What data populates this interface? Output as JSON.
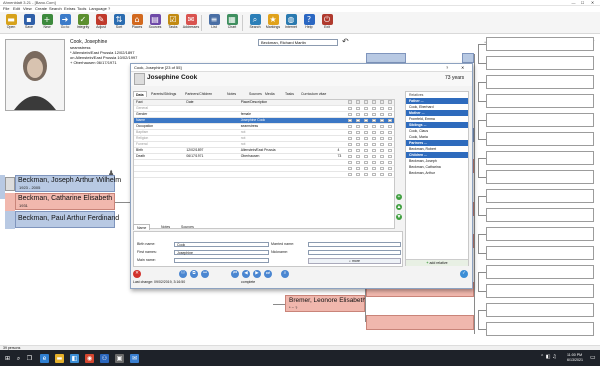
{
  "window": {
    "title": "Ahnenblatt 3.21 - [Bano.Com]",
    "min": "—",
    "max": "☐",
    "close": "✕"
  },
  "menu": [
    "File",
    "Edit",
    "View",
    "Create",
    "Search",
    "Extras",
    "Tools",
    "Language",
    "?"
  ],
  "toolbar": [
    {
      "label": "Open",
      "icon": "folder-icon",
      "color": "#d7a21b",
      "glyph": "▬"
    },
    {
      "label": "Save",
      "icon": "save-icon",
      "color": "#2f5fa8",
      "glyph": "▪"
    },
    {
      "label": "New",
      "icon": "new-person-icon",
      "color": "#3d8a3d",
      "glyph": "+"
    },
    {
      "label": "Go to",
      "icon": "goto-icon",
      "color": "#3b7bc9",
      "glyph": "➜"
    },
    {
      "label": "Integrity",
      "icon": "integrity-icon",
      "color": "#5b8f2f",
      "glyph": "✓"
    },
    {
      "label": "Adjust",
      "icon": "adjust-icon",
      "color": "#c0392b",
      "glyph": "✎"
    },
    {
      "label": "Sort",
      "icon": "sort-icon",
      "color": "#2b6cb0",
      "glyph": "⇅"
    },
    {
      "label": "Places",
      "icon": "places-icon",
      "color": "#d2691e",
      "glyph": "⌂"
    },
    {
      "label": "Sources",
      "icon": "sources-icon",
      "color": "#6f4aa8",
      "glyph": "▤"
    },
    {
      "label": "Tasks",
      "icon": "tasks-icon",
      "color": "#c28a12",
      "glyph": "☑"
    },
    {
      "label": "Addresses",
      "icon": "addresses-icon",
      "color": "#d9534f",
      "glyph": "✉"
    },
    {
      "label": "List",
      "icon": "list-icon",
      "color": "#4a6fa5",
      "glyph": "≡"
    },
    {
      "label": "Chart",
      "icon": "chart-icon",
      "color": "#3f8f5f",
      "glyph": "▦"
    },
    {
      "label": "Search",
      "icon": "search-icon",
      "color": "#2c7fb8",
      "glyph": "⌕"
    },
    {
      "label": "Markings",
      "icon": "markings-icon",
      "color": "#e0a21b",
      "glyph": "★"
    },
    {
      "label": "Internet",
      "icon": "internet-icon",
      "color": "#2a7ab0",
      "glyph": "◍"
    },
    {
      "label": "Help",
      "icon": "help-icon",
      "color": "#2b67c2",
      "glyph": "?"
    },
    {
      "label": "Exit",
      "icon": "exit-icon",
      "color": "#b03a2e",
      "glyph": "⏻"
    }
  ],
  "header_person": {
    "name": "Cook, Josephine",
    "occupation": "seamstress",
    "birth": "* Allenstein/East Prussia 12/02/1897",
    "death": "on Allenstein/East Prussia 10/02/1997",
    "death2": "+ Oberhausen 06/17/1971"
  },
  "nav_combo": "Beckman, Richard Martin",
  "persons": [
    {
      "name": "Beckman, Joseph Arthur Wilhelm",
      "dates": "1923 - 2005",
      "gender": "m"
    },
    {
      "name": "Beckman, Catharine Elisabeth",
      "dates": "1931",
      "gender": "f"
    },
    {
      "name": "Beckman, Paul Arthur Ferdinand",
      "dates": "",
      "gender": "m"
    },
    {
      "name": "Bremer, Leonore Elisabeth",
      "dates": "* ~ ?",
      "gender": "f"
    }
  ],
  "dialog": {
    "title": "Cook, Josephine [23 of 55]",
    "person_name": "Josephine Cook",
    "age": "73 years",
    "tabs": [
      "Data",
      "Parents/Siblings",
      "Partners/Children",
      "Notes",
      "Sources",
      "Media",
      "Tasks",
      "Curriculum vitae"
    ],
    "columns": [
      "Fact",
      "Date",
      "Place/Description"
    ],
    "facts": [
      {
        "fact": "General",
        "date": "",
        "place": "",
        "n": "",
        "sel": false,
        "grey": true
      },
      {
        "fact": "Gender",
        "date": "",
        "place": "female",
        "n": "",
        "sel": false,
        "grey": false
      },
      {
        "fact": "Name",
        "date": "",
        "place": "Josephine Cook",
        "n": "",
        "sel": true,
        "grey": false
      },
      {
        "fact": "Occupation",
        "date": "",
        "place": "seamstress",
        "n": "",
        "sel": false,
        "grey": false
      },
      {
        "fact": "Baptism",
        "date": "",
        "place": "not",
        "n": "",
        "sel": false,
        "grey": true
      },
      {
        "fact": "Religion",
        "date": "",
        "place": "not",
        "n": "",
        "sel": false,
        "grey": true
      },
      {
        "fact": "Funeral",
        "date": "",
        "place": "not",
        "n": "",
        "sel": false,
        "grey": true
      },
      {
        "fact": "Birth",
        "date": "12/02/1897",
        "place": "Allenstein/East Prussia",
        "n": "4",
        "sel": false,
        "grey": false
      },
      {
        "fact": "Death",
        "date": "06/17/1971",
        "place": "Oberhausen",
        "n": "73",
        "sel": false,
        "grey": false
      },
      {
        "fact": "",
        "date": "",
        "place": "",
        "n": "",
        "sel": false,
        "grey": false
      },
      {
        "fact": "",
        "date": "",
        "place": "",
        "n": "",
        "sel": false,
        "grey": false
      },
      {
        "fact": "",
        "date": "",
        "place": "",
        "n": "",
        "sel": false,
        "grey": false
      }
    ],
    "relatives": [
      {
        "label": "Relatives",
        "type": "plain"
      },
      {
        "label": "Father ...",
        "type": "head"
      },
      {
        "label": "Cook, Eberhard",
        "type": "plain"
      },
      {
        "label": "Mother ...",
        "type": "head"
      },
      {
        "label": "Fromfeld, Emma",
        "type": "plain"
      },
      {
        "label": "Siblings ...",
        "type": "head"
      },
      {
        "label": "Cook, Claus",
        "type": "plain"
      },
      {
        "label": "Cook, Maria",
        "type": "plain"
      },
      {
        "label": "Partners ...",
        "type": "head"
      },
      {
        "label": "Beckman, Robert",
        "type": "plain"
      },
      {
        "label": "Children ...",
        "type": "head"
      },
      {
        "label": "Beckman, Joseph",
        "type": "plain"
      },
      {
        "label": "Beckman, Catharina",
        "type": "plain"
      },
      {
        "label": "Beckman, Arthur",
        "type": "plain"
      }
    ],
    "add_relative": "add relative",
    "bottom_tabs": [
      "Name",
      "Notes",
      "Sources"
    ],
    "name_fields": {
      "birth_name_label": "Birth name:",
      "birth_name": "Cook",
      "first_names_label": "First names:",
      "first_names": "Josephine",
      "main_name_label": "Main name:",
      "main_name": "",
      "married_name_label": "Married name:",
      "married_name": "",
      "nickname_label": "Nickname:",
      "nickname": "",
      "more_label": "more"
    },
    "last_change": "Last change: 09/02/2019, 3:16:50",
    "status": "complete"
  },
  "statusbar": "39 persons",
  "taskbar": {
    "time": "11:00 PM",
    "date": "6/13/2021"
  }
}
